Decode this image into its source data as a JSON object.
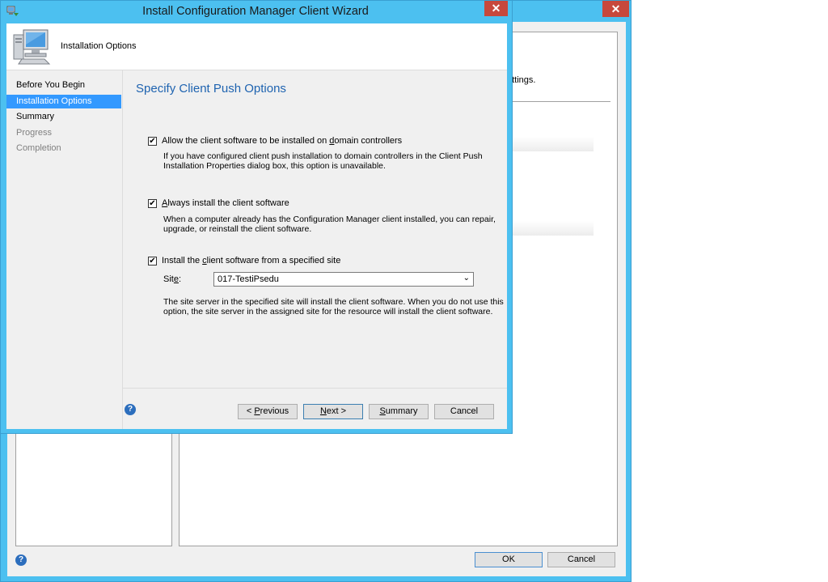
{
  "background_window": {
    "close_glyph": "✕",
    "partial_text": "ettings.",
    "help_glyph": "?",
    "ok_label": "OK",
    "cancel_label": "Cancel"
  },
  "wizard": {
    "title": "Install Configuration Manager Client Wizard",
    "close_glyph": "✕",
    "header_text": "Installation Options",
    "nav_items": [
      {
        "label": "Before You Begin",
        "state": "normal"
      },
      {
        "label": "Installation Options",
        "state": "active"
      },
      {
        "label": "Summary",
        "state": "normal"
      },
      {
        "label": "Progress",
        "state": "disabled"
      },
      {
        "label": "Completion",
        "state": "disabled"
      }
    ],
    "heading": "Specify Client Push Options",
    "options": [
      {
        "checked": true,
        "label_pre": "Allow the client software to be installed on ",
        "label_u": "d",
        "label_post": "omain controllers",
        "desc_line1": "If you have configured client push installation to domain controllers in the Client Push",
        "desc_line2": "Installation Properties dialog box, this option is unavailable."
      },
      {
        "checked": true,
        "label_pre": "",
        "label_u": "A",
        "label_post": "lways install the client software",
        "desc_line1": "When a computer already has the Configuration Manager client installed, you can repair,",
        "desc_line2": "upgrade, or reinstall the client software."
      },
      {
        "checked": true,
        "label_pre": "Install the ",
        "label_u": "c",
        "label_post": "lient software from a specified site"
      }
    ],
    "site_label_pre": "Sit",
    "site_label_u": "e",
    "site_label_post": ":",
    "site_value": "017-TestiPsedu",
    "site_desc_line1": "The site server in the specified site will install the client software.  When you do not use this",
    "site_desc_line2": "option, the site server in the assigned site for the resource will install the client software.",
    "help_glyph": "?",
    "buttons": {
      "previous_pre": "< ",
      "previous_u": "P",
      "previous_post": "revious",
      "next_u": "N",
      "next_post": "ext >",
      "summary_u": "S",
      "summary_post": "ummary",
      "cancel": "Cancel"
    },
    "check_glyph": "✔",
    "chevron_glyph": "⌄"
  }
}
